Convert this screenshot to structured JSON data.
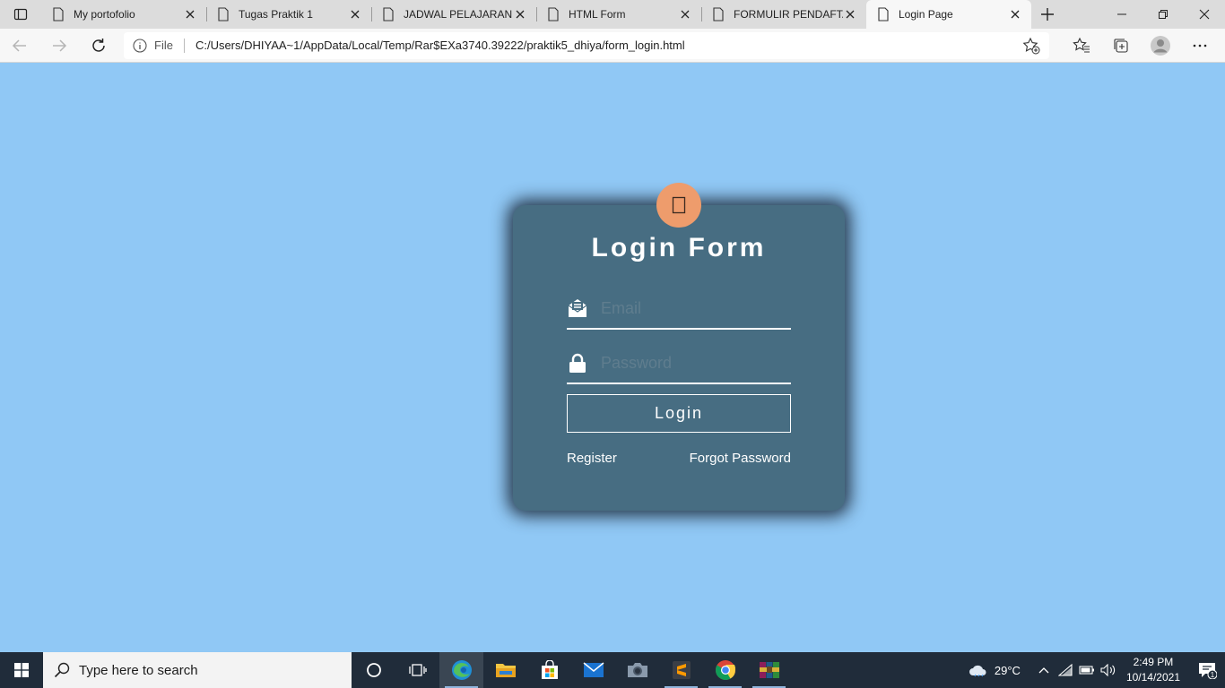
{
  "browser": {
    "tabs": [
      {
        "title": "My portofolio",
        "active": false
      },
      {
        "title": "Tugas Praktik 1",
        "active": false
      },
      {
        "title": "JADWAL PELAJARAN K",
        "active": false
      },
      {
        "title": "HTML Form",
        "active": false
      },
      {
        "title": "FORMULIR PENDAFTA",
        "active": false
      },
      {
        "title": "Login Page",
        "active": true
      }
    ],
    "address": {
      "scheme_label": "File",
      "url": "C:/Users/DHIYAA~1/AppData/Local/Temp/Rar$EXa3740.39222/praktik5_dhiya/form_login.html"
    }
  },
  "page": {
    "background": "#90c8f5",
    "card_color": "#476d82",
    "avatar_color": "#ee9c6c",
    "title": "Login Form",
    "email": {
      "placeholder": "Email",
      "value": ""
    },
    "password": {
      "placeholder": "Password",
      "value": ""
    },
    "login_label": "Login",
    "register_label": "Register",
    "forgot_label": "Forgot Password"
  },
  "taskbar": {
    "search_placeholder": "Type here to search",
    "weather_temp": "29°C",
    "time": "2:49 PM",
    "date": "10/14/2021",
    "notification_count": "1",
    "apps": [
      "task-view",
      "edge",
      "file-explorer",
      "microsoft-store",
      "mail",
      "camera",
      "sublime-text",
      "chrome",
      "winrar"
    ]
  }
}
